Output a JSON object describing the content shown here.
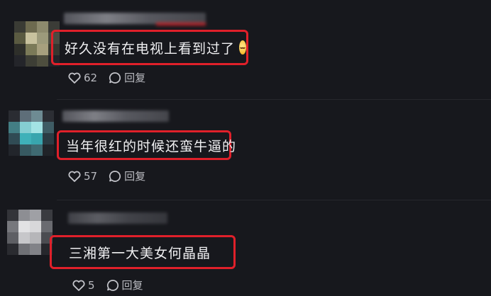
{
  "comments": [
    {
      "text": "好久没有在电视上看到过了",
      "emoji_icon": "smiling-face-emoji",
      "likes": "62",
      "reply_label": "回复"
    },
    {
      "text": "当年很红的时候还蛮牛逼的",
      "likes": "57",
      "reply_label": "回复"
    },
    {
      "text": "三湘第一大美女何晶晶",
      "likes": "5",
      "reply_label": "回复"
    }
  ],
  "colors": {
    "background": "#17181d",
    "highlight_border": "#e0202a",
    "action_text": "#b9bac0"
  }
}
